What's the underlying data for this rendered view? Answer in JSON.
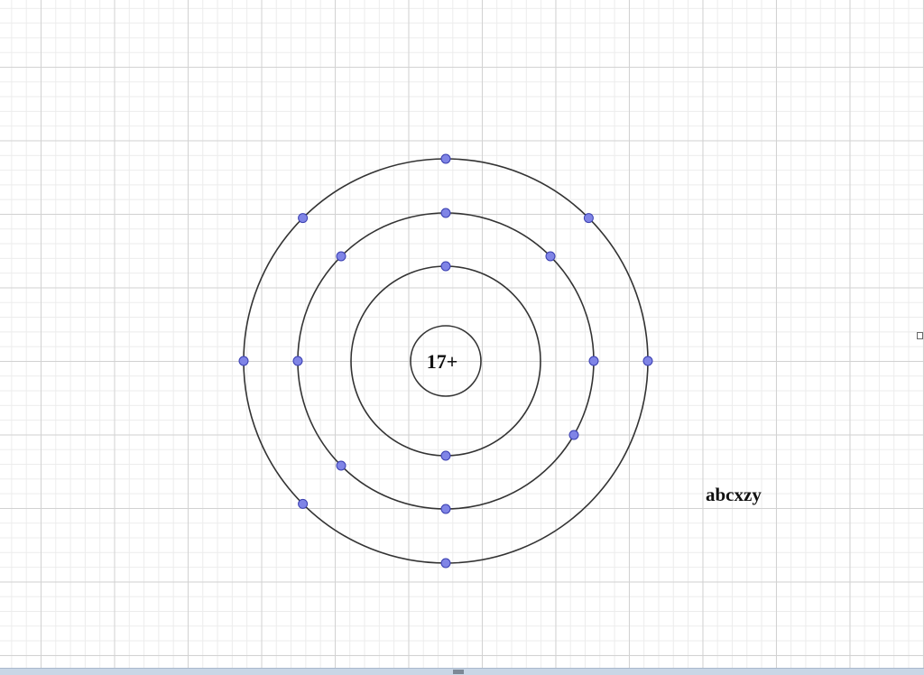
{
  "atom": {
    "nucleus_label": "17+",
    "shells": [
      {
        "electrons": 2
      },
      {
        "electrons": 8
      },
      {
        "electrons": 7
      }
    ]
  },
  "side_label": "abcxzy",
  "colors": {
    "grid_major": "#d2d2d2",
    "grid_minor": "#ececec",
    "orbit_stroke": "#333333",
    "electron_fill": "#7f84e6",
    "electron_stroke": "#3a3fb0"
  }
}
